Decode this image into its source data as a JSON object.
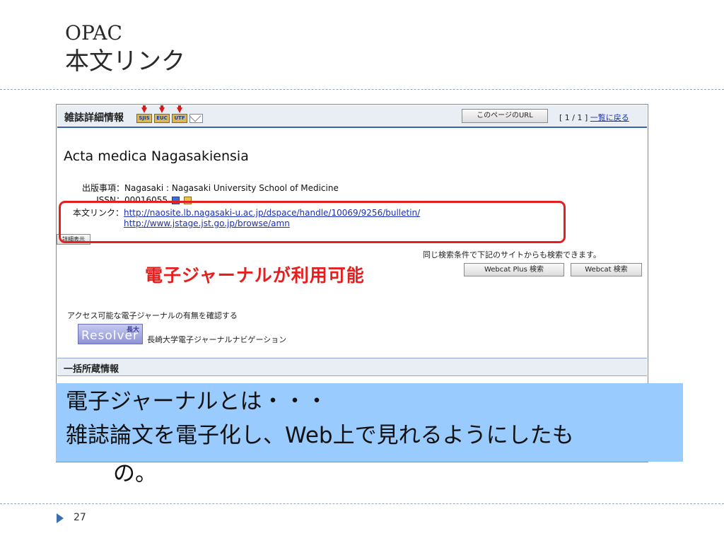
{
  "slide": {
    "title_line1": "OPAC",
    "title_line2": "本文リンク",
    "page_number": "27"
  },
  "screenshot": {
    "header": {
      "title": "雑誌詳細情報",
      "export_icons": [
        "SJIS",
        "EUC",
        "UTF"
      ],
      "page_url_button": "このページのURL",
      "pager_text": "[ 1 / 1 ]",
      "back_link": "一覧に戻る"
    },
    "journal_title": "Acta medica Nagasakiensia",
    "publication": {
      "label": "出版事項：",
      "value": "Nagasaki : Nagasaki University School of Medicine"
    },
    "issn": {
      "label": "ISSN：",
      "value": "00016055"
    },
    "fulltext": {
      "label": "本文リンク：",
      "links": [
        "http://naosite.lb.nagasaki-u.ac.jp/dspace/handle/10069/9256/bulletin/",
        "http://www.jstage.jst.go.jp/browse/amn"
      ]
    },
    "detail_button": "詳細表示",
    "same_search_text": "同じ検索条件で下記のサイトからも検索できます。",
    "webcat_plus_button": "Webcat Plus 検索",
    "webcat_button": "Webcat 検索",
    "access_text": "アクセス可能な電子ジャーナルの有無を確認する",
    "resolver_logo": "Resolver",
    "resolver_badge": "長大",
    "navigation_label": "長崎大学電子ジャーナルナビゲーション",
    "holdings_header": "一括所蔵情報"
  },
  "annotation": {
    "red_text": "電子ジャーナルが利用可能",
    "red_color": "#e51f1f"
  },
  "callout": {
    "line1": "電子ジャーナルとは・・・",
    "line2": "雑誌論文を電子化し、Web上で見れるようにしたも",
    "line3": "の。",
    "background": "#99cbff"
  }
}
